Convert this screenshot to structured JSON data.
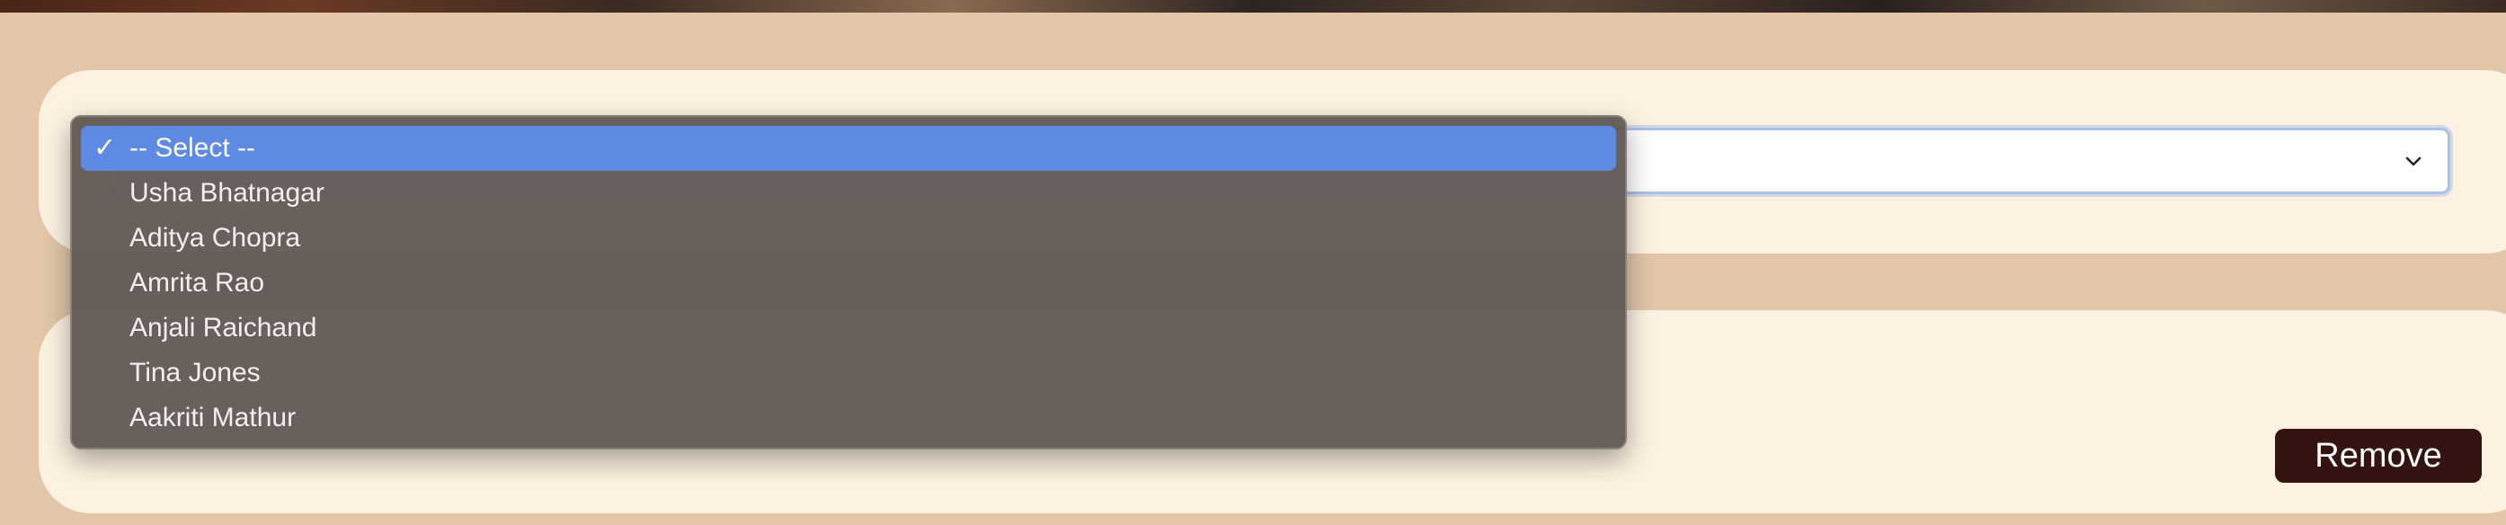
{
  "select": {
    "current_value": "-- Select --",
    "options": [
      "-- Select --",
      "Usha Bhatnagar",
      "Aditya Chopra",
      "Amrita Rao",
      "Anjali Raichand",
      "Tina Jones",
      "Aakriti Mathur"
    ],
    "check_glyph": "✓"
  },
  "actions": {
    "remove_label": "Remove"
  },
  "colors": {
    "page_background": "#e2c6a7",
    "card_background": "#fdf1e1",
    "dropdown_background": "#625a55",
    "selected_option": "#5f8ae3",
    "remove_button": "#341411"
  },
  "icons": {
    "select_arrow": "chevron-down-icon",
    "selected_mark": "checkmark-icon"
  }
}
